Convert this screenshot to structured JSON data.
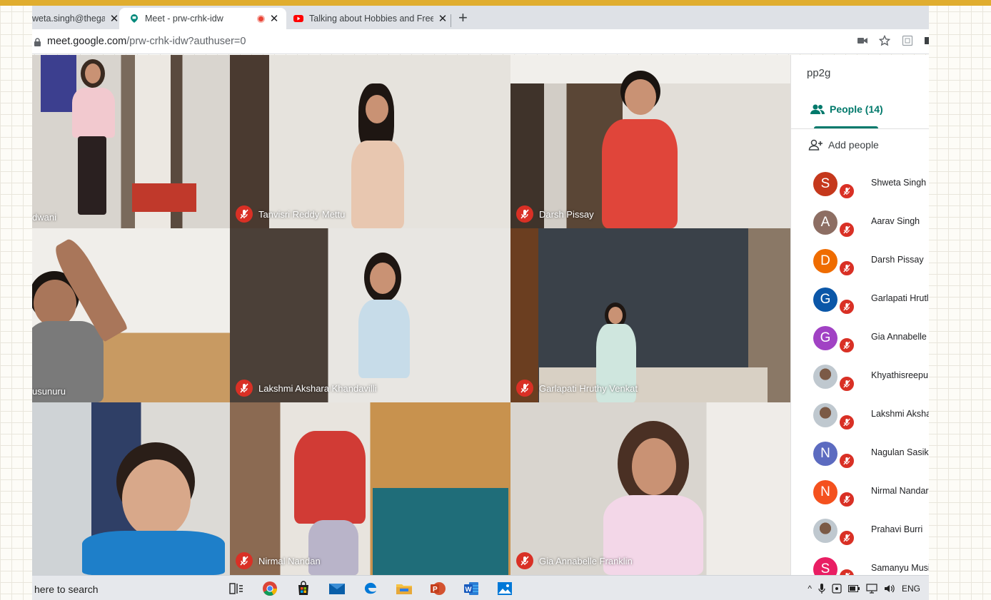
{
  "browser": {
    "tabs": [
      {
        "title": "weta.singh@thega",
        "icon": "partial-tab",
        "active": false
      },
      {
        "title": "Meet - prw-crhk-idw",
        "icon": "meet-icon",
        "recording": true,
        "active": true
      },
      {
        "title": "Talking about Hobbies and Free",
        "icon": "youtube-icon",
        "active": false
      }
    ],
    "new_tab_symbol": "+",
    "close_symbol": "✕",
    "url_host": "meet.google.com",
    "url_path": "/prw-crhk-idw?authuser=0",
    "address_icons": [
      "camera-icon",
      "star-icon",
      "extension-icon",
      "puzzle-icon"
    ]
  },
  "meet": {
    "tiles": [
      {
        "name": "dwani",
        "muted": false
      },
      {
        "name": "Tanvisri Reddy Mettu",
        "muted": true
      },
      {
        "name": "Darsh Pissay",
        "muted": true
      },
      {
        "name": "usunuru",
        "muted": false
      },
      {
        "name": "Lakshmi Akshara Khandavilli",
        "muted": true
      },
      {
        "name": "Garlapati Hruthy Venkat",
        "muted": true
      },
      {
        "name": "",
        "muted": false
      },
      {
        "name": "Nirmal Nandan",
        "muted": true
      },
      {
        "name": "Gia Annabelle Franklin",
        "muted": true
      }
    ]
  },
  "panel": {
    "meeting_code": "pp2g",
    "people_tab_label": "People (14)",
    "add_people_label": "Add people",
    "people": [
      {
        "name": "Shweta Singh (",
        "initial": "S",
        "color": "#c5381c",
        "photo": false
      },
      {
        "name": "Aarav Singh",
        "initial": "A",
        "color": "#8d6e63",
        "photo": false
      },
      {
        "name": "Darsh Pissay",
        "initial": "D",
        "color": "#ef6c00",
        "photo": false
      },
      {
        "name": "Garlapati Hrutl",
        "initial": "G",
        "color": "#0b57a8",
        "photo": false
      },
      {
        "name": "Gia Annabelle",
        "initial": "G",
        "color": "#a142c4",
        "photo": false
      },
      {
        "name": "Khyathisreepu:",
        "initial": "",
        "color": "#9fb4c2",
        "photo": true
      },
      {
        "name": "Lakshmi Aksha",
        "initial": "",
        "color": "#9fb4c2",
        "photo": true
      },
      {
        "name": "Nagulan Sasik",
        "initial": "N",
        "color": "#5c6bc0",
        "photo": false
      },
      {
        "name": "Nirmal Nandar",
        "initial": "N",
        "color": "#f4511e",
        "photo": false
      },
      {
        "name": "Prahavi Burri",
        "initial": "",
        "color": "#9fb4c2",
        "photo": true
      },
      {
        "name": "Samanyu Musi",
        "initial": "S",
        "color": "#e91e63",
        "photo": false
      }
    ]
  },
  "taskbar": {
    "search_text": "here to search",
    "apps": [
      "task-view-icon",
      "chrome-icon",
      "store-icon",
      "mail-icon",
      "edge-icon",
      "file-explorer-icon",
      "powerpoint-icon",
      "word-icon",
      "photos-icon"
    ],
    "language": "ENG"
  },
  "colors": {
    "accent_band": "#e0ad2f",
    "mute_red": "#d93025",
    "meet_teal": "#00796b"
  }
}
